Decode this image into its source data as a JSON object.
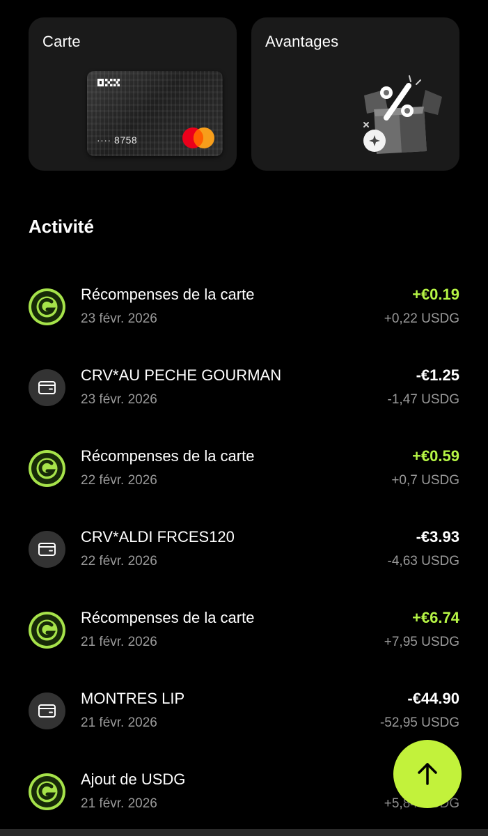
{
  "tiles": {
    "card": {
      "title": "Carte",
      "card_number": "···· 8758",
      "brand_logo": "OKX"
    },
    "perks": {
      "title": "Avantages"
    }
  },
  "activity": {
    "title": "Activité",
    "transactions": [
      {
        "type": "reward",
        "title": "Récompenses de la carte",
        "date": "23 févr. 2026",
        "amount": "+€0.19",
        "sub_amount": "+0,22 USDG",
        "positive": true
      },
      {
        "type": "card",
        "title": "CRV*AU PECHE GOURMAN",
        "date": "23 févr. 2026",
        "amount": "-€1.25",
        "sub_amount": "-1,47 USDG",
        "positive": false
      },
      {
        "type": "reward",
        "title": "Récompenses de la carte",
        "date": "22 févr. 2026",
        "amount": "+€0.59",
        "sub_amount": "+0,7 USDG",
        "positive": true
      },
      {
        "type": "card",
        "title": "CRV*ALDI FRCES120",
        "date": "22 févr. 2026",
        "amount": "-€3.93",
        "sub_amount": "-4,63 USDG",
        "positive": false
      },
      {
        "type": "reward",
        "title": "Récompenses de la carte",
        "date": "21 févr. 2026",
        "amount": "+€6.74",
        "sub_amount": "+7,95 USDG",
        "positive": true
      },
      {
        "type": "card",
        "title": "MONTRES LIP",
        "date": "21 févr. 2026",
        "amount": "-€44.90",
        "sub_amount": "-52,95 USDG",
        "positive": false
      },
      {
        "type": "reward",
        "title": "Ajout de USDG",
        "date": "21 févr. 2026",
        "amount": "",
        "sub_amount": "+5,84 USDG",
        "positive": true
      }
    ]
  },
  "icons": {
    "reward": "usdg-coin-icon",
    "card": "wallet-card-icon",
    "fab": "arrow-up-icon"
  },
  "colors": {
    "background": "#000000",
    "tile": "#1a1a1a",
    "accent_green": "#b6f545",
    "fab_green": "#c2f23b",
    "muted_text": "#9a9a9a"
  }
}
